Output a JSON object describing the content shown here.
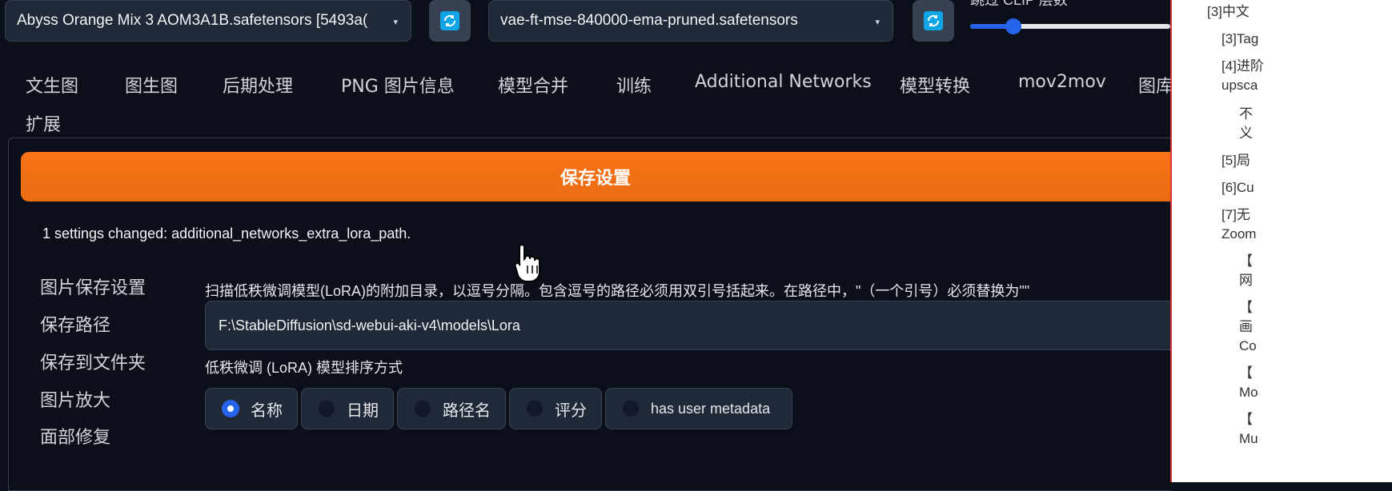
{
  "top": {
    "model_select": "Abyss Orange Mix 3 AOM3A1B.safetensors [5493a(",
    "vae_select": "vae-ft-mse-840000-ema-pruned.safetensors",
    "clip_label": "跳过 CLIP 层数"
  },
  "tabs": [
    "文生图",
    "图生图",
    "后期处理",
    "PNG 图片信息",
    "模型合并",
    "训练",
    "Additional Networks",
    "模型转换",
    "mov2mov",
    "图库",
    "扩展"
  ],
  "settings": {
    "save_button": "保存设置",
    "status": "1 settings changed: additional_networks_extra_lora_path.",
    "sidebar": [
      "图片保存设置",
      "保存路径",
      "保存到文件夹",
      "图片放大",
      "面部修复"
    ],
    "lora_path_label": "扫描低秩微调模型(LoRA)的附加目录，以逗号分隔。包含逗号的路径必须用双引号括起来。在路径中，\"（一个引号）必须替换为\"\"",
    "lora_path_value": "F:\\StableDiffusion\\sd-webui-aki-v4\\models\\Lora",
    "sort_label": "低秩微调 (LoRA) 模型排序方式",
    "sort_options": [
      "名称",
      "日期",
      "路径名",
      "评分",
      "has user metadata"
    ],
    "sort_selected": "名称"
  },
  "right_pane": {
    "items": [
      "[3]中文",
      "[3]Tag",
      "[4]进阶",
      "upsca",
      "不",
      "义",
      "[5]局",
      "[6]Cu",
      "[7]无",
      "Zoom",
      "【",
      "网",
      "【",
      "画",
      "Co",
      "【",
      "Mo",
      "【",
      "Mu"
    ]
  },
  "colors": {
    "accent_orange": "#f97316",
    "accent_blue": "#2563eb",
    "background": "#0b0f19",
    "divider_red": "#d73a3a"
  }
}
